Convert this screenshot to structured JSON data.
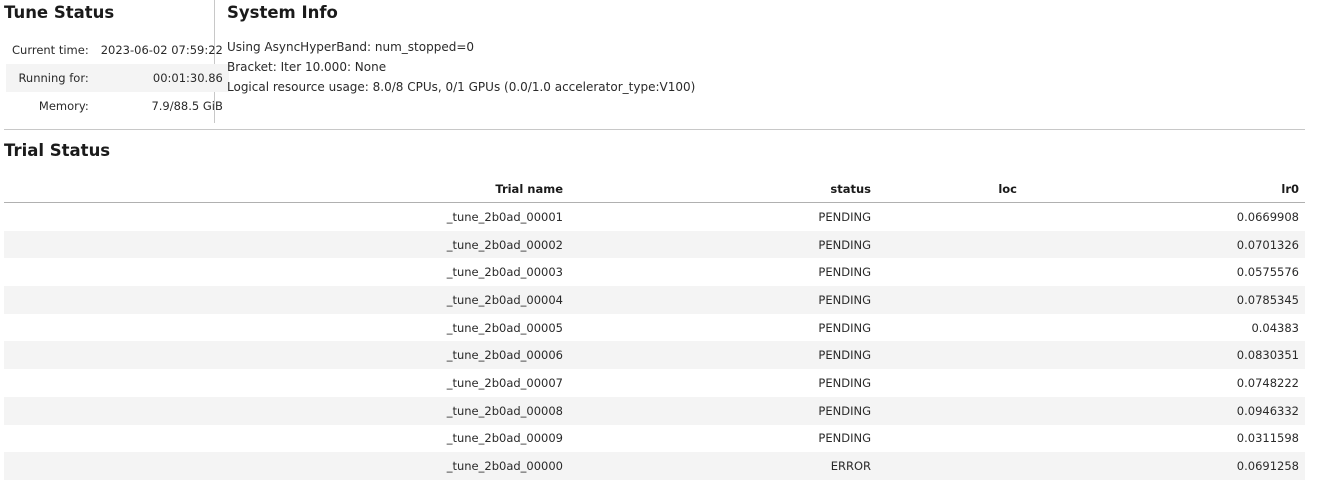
{
  "tune_status": {
    "title": "Tune Status",
    "rows": [
      {
        "label": "Current time:",
        "value": "2023-06-02 07:59:22"
      },
      {
        "label": "Running for:",
        "value": "00:01:30.86"
      },
      {
        "label": "Memory:",
        "value": "7.9/88.5 GiB"
      }
    ]
  },
  "system_info": {
    "title": "System Info",
    "lines": [
      "Using AsyncHyperBand: num_stopped=0",
      "Bracket: Iter 10.000: None",
      "Logical resource usage: 8.0/8 CPUs, 0/1 GPUs (0.0/1.0 accelerator_type:V100)"
    ]
  },
  "trial_status": {
    "title": "Trial Status",
    "columns": {
      "trial_name": "Trial name",
      "status": "status",
      "loc": "loc",
      "lr0": "lr0"
    },
    "rows": [
      {
        "trial_name": "_tune_2b0ad_00001",
        "status": "PENDING",
        "loc": "",
        "lr0": "0.0669908"
      },
      {
        "trial_name": "_tune_2b0ad_00002",
        "status": "PENDING",
        "loc": "",
        "lr0": "0.0701326"
      },
      {
        "trial_name": "_tune_2b0ad_00003",
        "status": "PENDING",
        "loc": "",
        "lr0": "0.0575576"
      },
      {
        "trial_name": "_tune_2b0ad_00004",
        "status": "PENDING",
        "loc": "",
        "lr0": "0.0785345"
      },
      {
        "trial_name": "_tune_2b0ad_00005",
        "status": "PENDING",
        "loc": "",
        "lr0": "0.04383"
      },
      {
        "trial_name": "_tune_2b0ad_00006",
        "status": "PENDING",
        "loc": "",
        "lr0": "0.0830351"
      },
      {
        "trial_name": "_tune_2b0ad_00007",
        "status": "PENDING",
        "loc": "",
        "lr0": "0.0748222"
      },
      {
        "trial_name": "_tune_2b0ad_00008",
        "status": "PENDING",
        "loc": "",
        "lr0": "0.0946332"
      },
      {
        "trial_name": "_tune_2b0ad_00009",
        "status": "PENDING",
        "loc": "",
        "lr0": "0.0311598"
      },
      {
        "trial_name": "_tune_2b0ad_00000",
        "status": "ERROR",
        "loc": "",
        "lr0": "0.0691258"
      }
    ]
  }
}
